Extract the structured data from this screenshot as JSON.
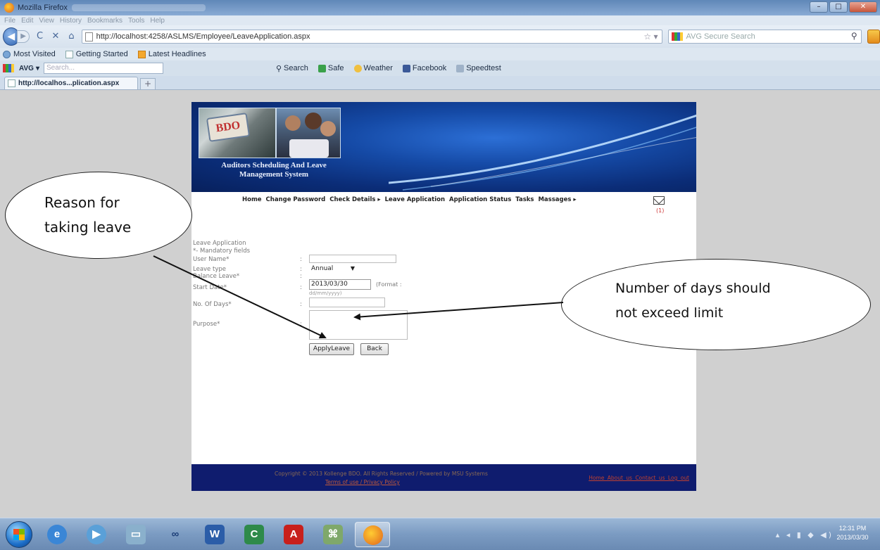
{
  "window": {
    "title": "Mozilla Firefox",
    "minimize": "–",
    "maximize": "□",
    "close": "✕"
  },
  "menu": [
    "File",
    "Edit",
    "View",
    "History",
    "Bookmarks",
    "Tools",
    "Help"
  ],
  "navigation": {
    "url": "http://localhost:4258/ASLMS/Employee/LeaveApplication.aspx",
    "search_placeholder": "AVG Secure Search",
    "back": "◀",
    "forward": "▶",
    "reload": "C",
    "stop": "✕",
    "home": "⌂"
  },
  "bookmarks": [
    "Most Visited",
    "Getting Started",
    "Latest Headlines"
  ],
  "avg_toolbar": {
    "brand": "AVG",
    "search_placeholder": "Search...",
    "tools": [
      "Search",
      "Safe",
      "Weather",
      "Facebook",
      "Speedtest"
    ]
  },
  "tab": {
    "label": "http://localhos...plication.aspx",
    "new_tab": "+"
  },
  "app": {
    "bdo_logo": "BDO",
    "banner_line1": "Auditors Scheduling And Leave",
    "banner_line2": "Management System",
    "menu": [
      "Home",
      "Change Password",
      "Check Details ▸",
      "Leave Application",
      "Application Status",
      "Tasks",
      "Massages ▸"
    ],
    "mail_count": "(1)"
  },
  "form": {
    "heading": "Leave Application",
    "mandatory_note": "*- Mandatory fields",
    "user_name_label": "User Name*",
    "leave_type_label": "Leave type",
    "leave_type_value": "Annual",
    "balance_label": "Balance Leave*",
    "start_date_label": "Start Date*",
    "start_date_value": "2013/03/30",
    "format_label": "(Format :",
    "format_value": "dd/mm/yyyy)",
    "days_label": "No. Of Days*",
    "purpose_label": "Purpose*",
    "apply_button": "ApplyLeave",
    "back_button": "Back",
    "colon": ":"
  },
  "footer": {
    "copyright": "Copyright © 2013 Kollenge BDO. All Rights Reserved / Powered by  MSU Systems",
    "links": "Terms of use  /  Privacy Policy",
    "right_links": "Home  About us  Contact us  Log out"
  },
  "annotations": {
    "left_line1": "Reason for",
    "left_line2": "taking leave",
    "right_line1": "Number of days should",
    "right_line2": "not exceed limit"
  },
  "taskbar": {
    "apps": [
      "ie-icon",
      "media-player-icon",
      "explorer-icon",
      "link-icon",
      "word-icon",
      "c-app-icon",
      "acrobat-icon",
      "network-icon",
      "firefox-icon"
    ],
    "time": "12:31 PM",
    "date": "2013/03/30"
  },
  "colors": {
    "banner": "#0b2d78",
    "footer": "#0f1c6e",
    "callout_border": "#222222"
  }
}
